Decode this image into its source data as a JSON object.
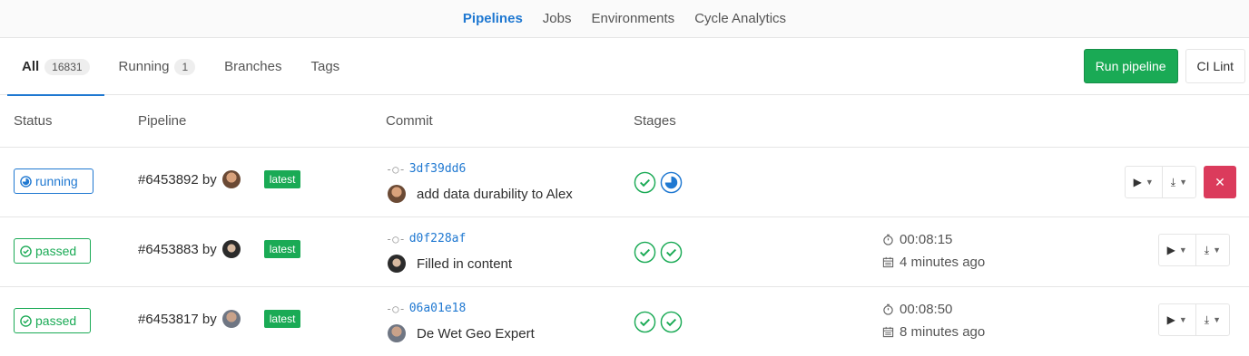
{
  "subnav": {
    "items": [
      "Pipelines",
      "Jobs",
      "Environments",
      "Cycle Analytics"
    ]
  },
  "tabs": [
    {
      "label": "All",
      "count": "16831"
    },
    {
      "label": "Running",
      "count": "1"
    },
    {
      "label": "Branches"
    },
    {
      "label": "Tags"
    }
  ],
  "actions": {
    "run_pipeline": "Run pipeline",
    "ci_lint": "CI Lint"
  },
  "table": {
    "headers": [
      "Status",
      "Pipeline",
      "Commit",
      "Stages"
    ],
    "rows": [
      {
        "status": "running",
        "pipeline": "#6453892 by",
        "badge": "latest",
        "sha": "3df39dd6",
        "message": "add data durability to Alex",
        "duration": "",
        "finished": ""
      },
      {
        "status": "passed",
        "pipeline": "#6453883 by",
        "badge": "latest",
        "sha": "d0f228af",
        "message": "Filled in content",
        "duration": "00:08:15",
        "finished": "4 minutes ago"
      },
      {
        "status": "passed",
        "pipeline": "#6453817 by",
        "badge": "latest",
        "sha": "06a01e18",
        "message": "De Wet Geo Expert",
        "duration": "00:08:50",
        "finished": "8 minutes ago"
      }
    ]
  },
  "icons": {
    "status_running": "running-status-icon",
    "status_passed": "passed-status-icon",
    "stage_success": "stage-success-icon",
    "stage_running": "stage-running-icon",
    "duration": "timer-icon",
    "finished": "calendar-icon",
    "play": "play-icon",
    "download": "download-icon",
    "cancel": "cancel-icon"
  },
  "colors": {
    "accent": "#1f78d1",
    "success": "#1aaa55",
    "danger": "#db3b5c"
  }
}
